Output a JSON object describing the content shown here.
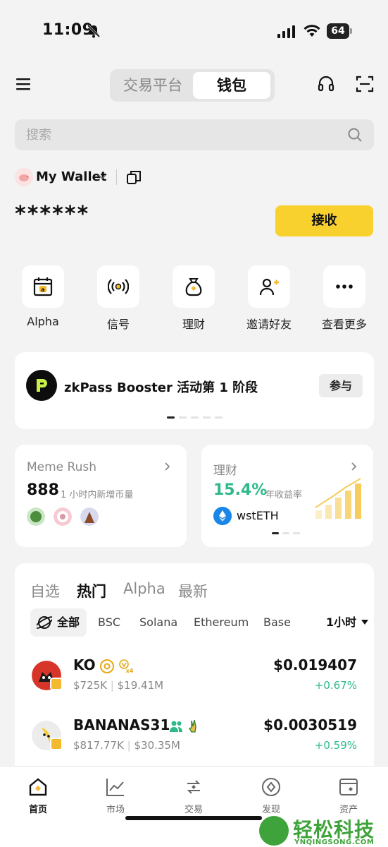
{
  "status_bar": {
    "time": "11:09",
    "battery": "64"
  },
  "header": {
    "tabs": [
      "交易平台",
      "钱包"
    ],
    "active_tab": "钱包"
  },
  "search": {
    "placeholder": "搜索"
  },
  "wallet": {
    "name": "My Wallet",
    "balance_masked": "******",
    "receive_label": "接收"
  },
  "quick_actions": [
    {
      "label": "Alpha",
      "icon": "alpha-calendar-icon"
    },
    {
      "label": "信号",
      "icon": "signal-broadcast-icon"
    },
    {
      "label": "理财",
      "icon": "money-bag-icon"
    },
    {
      "label": "邀请好友",
      "icon": "invite-user-icon"
    },
    {
      "label": "查看更多",
      "icon": "more-dots-icon"
    }
  ],
  "banner": {
    "title": "zkPass Booster 活动第 1 阶段",
    "action_label": "参与",
    "page_count": 5,
    "active_page": 1
  },
  "meme_card": {
    "title": "Meme Rush",
    "count": "888",
    "subtitle": "1 小时内新增币量"
  },
  "finance_card": {
    "title": "理财",
    "rate": "15.4%",
    "rate_label": "年收益率",
    "asset": "wstETH",
    "page_count": 3,
    "active_page": 1
  },
  "market": {
    "tabs": [
      "自选",
      "热门",
      "Alpha",
      "最新"
    ],
    "active_tab": "热门",
    "chains": [
      "全部",
      "BSC",
      "Solana",
      "Ethereum",
      "Base"
    ],
    "active_chain": "全部",
    "time_range": "1小时",
    "rows": [
      {
        "symbol": "KO",
        "market_cap": "$725K",
        "volume": "$19.41M",
        "price": "$0.019407",
        "change": "+0.67%"
      },
      {
        "symbol": "BANANAS31",
        "market_cap": "$817.77K",
        "volume": "$30.35M",
        "price": "$0.0030519",
        "change": "+0.59%"
      }
    ]
  },
  "nav": {
    "items": [
      "首页",
      "市场",
      "交易",
      "发现",
      "资产"
    ],
    "active": "首页"
  },
  "watermark": {
    "text": "轻松科技",
    "url": "YNQINGSONG.COM"
  },
  "colors": {
    "brand_yellow": "#f8d12f",
    "positive_green": "#2eb98b",
    "background": "#f3f3f3"
  }
}
